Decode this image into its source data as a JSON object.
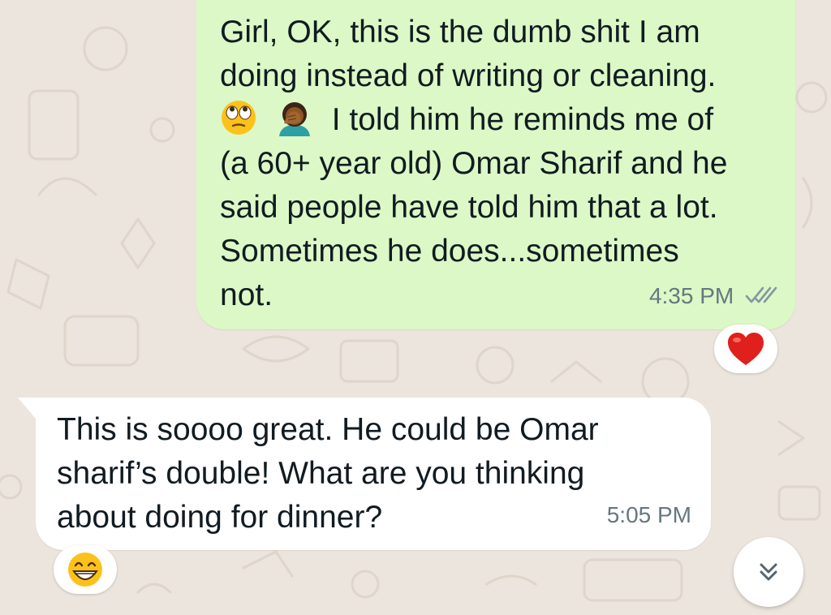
{
  "messages": [
    {
      "direction": "outgoing",
      "lines": [
        "Girl, OK, this is the dumb shit I am",
        "doing instead of writing or cleaning.",
        "I told him he reminds me of",
        "(a 60+ year old) Omar Sharif and he",
        "said people have told him that a lot.",
        "Sometimes he does...sometimes",
        "not."
      ],
      "inline_emojis": [
        "face-with-rolling-eyes-emoji",
        "person-facepalming-emoji"
      ],
      "time": "4:35 PM",
      "status": "read",
      "reaction": "red-heart-emoji"
    },
    {
      "direction": "incoming",
      "lines": [
        "This is soooo great. He could be Omar",
        "sharif’s double! What are you thinking",
        "about doing for dinner?"
      ],
      "time": "5:05 PM",
      "reaction": "grinning-face-with-smiling-eyes-emoji"
    }
  ],
  "scroll_button_icon": "double-chevron-down-icon",
  "colors": {
    "wallpaper": "#ece5dd",
    "outgoing_bubble": "#dcf8c6",
    "incoming_bubble": "#ffffff",
    "read_ticks": "#8696a0"
  }
}
